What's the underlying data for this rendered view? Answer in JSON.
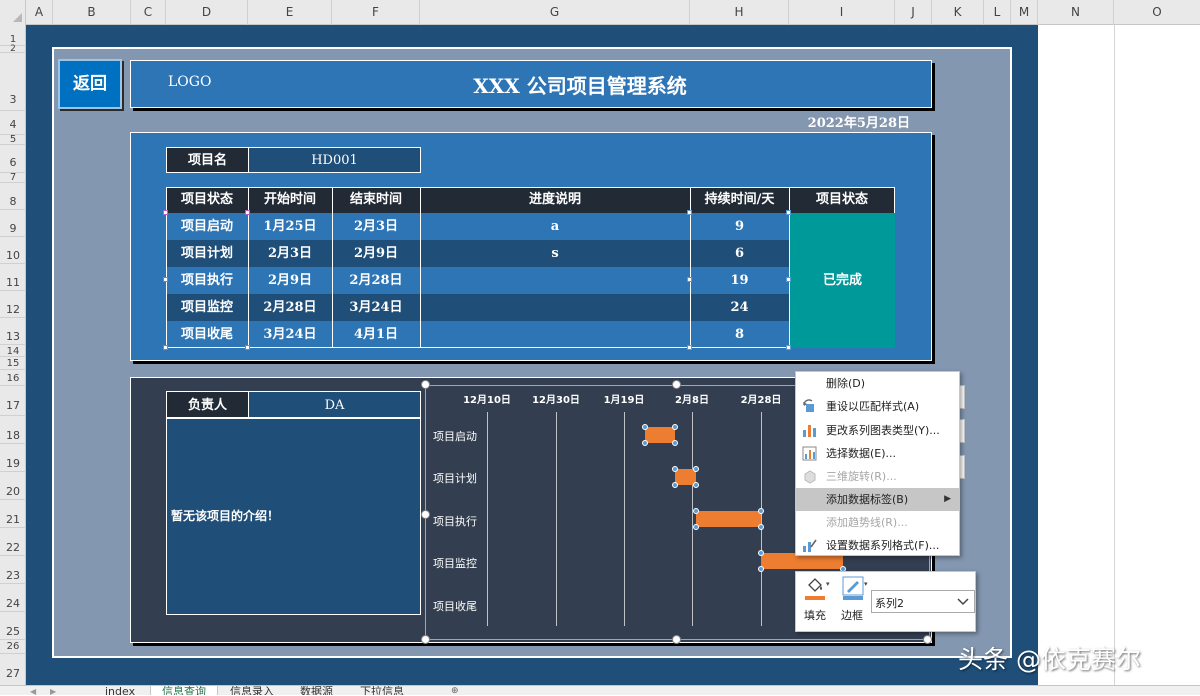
{
  "columns": [
    "A",
    "B",
    "C",
    "D",
    "E",
    "F",
    "G",
    "H",
    "I",
    "J",
    "K",
    "L",
    "M",
    "N",
    "O"
  ],
  "rows": [
    "1",
    "2",
    "3",
    "4",
    "5",
    "6",
    "7",
    "8",
    "9",
    "10",
    "11",
    "12",
    "13",
    "14",
    "15",
    "16",
    "17",
    "18",
    "19",
    "20",
    "21",
    "22",
    "23",
    "24",
    "25",
    "26",
    "27"
  ],
  "header": {
    "back_label": "返回",
    "logo": "LOGO",
    "title": "XXX 公司项目管理系统",
    "date": "2022年5月28日"
  },
  "project": {
    "name_label": "项目名",
    "name_value": "HD001",
    "columns": [
      "项目状态",
      "开始时间",
      "结束时间",
      "进度说明",
      "持续时间/天",
      "项目状态"
    ],
    "rows": [
      {
        "stage": "项目启动",
        "start": "1月25日",
        "end": "2月3日",
        "note": "a",
        "days": "9"
      },
      {
        "stage": "项目计划",
        "start": "2月3日",
        "end": "2月9日",
        "note": "s",
        "days": "6"
      },
      {
        "stage": "项目执行",
        "start": "2月9日",
        "end": "2月28日",
        "note": "",
        "days": "19"
      },
      {
        "stage": "项目监控",
        "start": "2月28日",
        "end": "3月24日",
        "note": "",
        "days": "24"
      },
      {
        "stage": "项目收尾",
        "start": "3月24日",
        "end": "4月1日",
        "note": "",
        "days": "8"
      }
    ],
    "status": "已完成",
    "colors": {
      "header": "#222a35",
      "row_light": "#2e75b6",
      "row_dark": "#1f4e79",
      "status": "#009999"
    }
  },
  "owner": {
    "label": "负责人",
    "value": "DA",
    "intro": "暂无该项目的介绍！"
  },
  "chart_data": {
    "type": "bar",
    "orientation": "horizontal",
    "categories": [
      "项目启动",
      "项目计划",
      "项目执行",
      "项目监控",
      "项目收尾"
    ],
    "x_tick_labels": [
      "12月10日",
      "12月30日",
      "1月19日",
      "2月8日",
      "2月28日"
    ],
    "series": [
      {
        "name": "系列2",
        "color": "#ed7d31",
        "start": [
          "2022-01-25",
          "2022-02-03",
          "2022-02-09",
          "2022-02-28",
          "2022-03-24"
        ],
        "duration_days": [
          9,
          6,
          19,
          24,
          8
        ]
      }
    ],
    "grid": true
  },
  "context_menu": {
    "items": [
      {
        "label": "删除(D)",
        "icon": "",
        "disabled": false
      },
      {
        "label": "重设以匹配样式(A)",
        "icon": "reset-style-icon",
        "disabled": false
      },
      {
        "label": "更改系列图表类型(Y)...",
        "icon": "chart-type-icon",
        "disabled": false
      },
      {
        "label": "选择数据(E)...",
        "icon": "select-data-icon",
        "disabled": false
      },
      {
        "label": "三维旋转(R)...",
        "icon": "3d-rotate-icon",
        "disabled": true
      },
      {
        "label": "添加数据标签(B)",
        "icon": "",
        "disabled": false,
        "highlighted": true,
        "submenu": true
      },
      {
        "label": "添加趋势线(R)...",
        "icon": "",
        "disabled": true
      },
      {
        "label": "设置数据系列格式(F)...",
        "icon": "format-series-icon",
        "disabled": false
      }
    ]
  },
  "mini_toolbar": {
    "fill_label": "填充",
    "border_label": "边框",
    "series_select": "系列2",
    "fill_color": "#ed7d31",
    "border_color": "#5b9bd5"
  },
  "sheet_tabs": [
    "index",
    "信息查询",
    "信息录入",
    "数据源",
    "下拉信息"
  ],
  "active_tab": "信息查询",
  "watermark": "头条 @依克赛尔"
}
